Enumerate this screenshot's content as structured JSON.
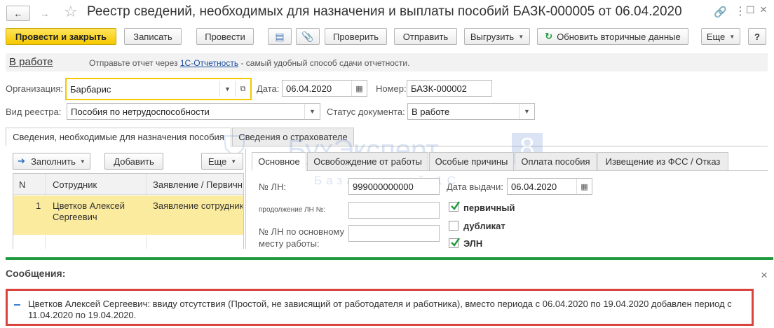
{
  "window": {
    "title": "Реестр сведений, необходимых для назначения и выплаты пособий БАЗК-000005 от 06.04.2020"
  },
  "toolbar": {
    "post_close": "Провести и закрыть",
    "save": "Записать",
    "post": "Провести",
    "check": "Проверить",
    "send": "Отправить",
    "upload": "Выгрузить",
    "refresh": "Обновить вторичные данные",
    "more": "Еще",
    "help": "?"
  },
  "status": {
    "state": "В работе",
    "hint_prefix": "Отправьте отчет через",
    "hint_link": "1С-Отчетность",
    "hint_suffix": "- самый удобный способ сдачи отчетности."
  },
  "form": {
    "org_label": "Организация:",
    "org_value": "Барбарис",
    "date_label": "Дата:",
    "date_value": "06.04.2020",
    "number_label": "Номер:",
    "number_value": "БАЗК-000002",
    "registry_type_label": "Вид реестра:",
    "registry_type_value": "Пособия по нетрудоспособности",
    "doc_status_label": "Статус документа:",
    "doc_status_value": "В работе"
  },
  "main_tabs": [
    "Сведения, необходимые для назначения пособия",
    "Сведения о страхователе"
  ],
  "left_panel": {
    "fill": "Заполнить",
    "add": "Добавить",
    "more": "Еще",
    "columns": [
      "N",
      "Сотрудник",
      "Заявление / Первичн"
    ],
    "rows": [
      {
        "n": "1",
        "employee": "Цветков Алексей Сергеевич",
        "application": "Заявление сотрудника"
      }
    ]
  },
  "sub_tabs": [
    "Основное",
    "Освобождение от работы",
    "Особые причины",
    "Оплата пособия",
    "Извещение из ФСС / Отказ"
  ],
  "detail": {
    "ln_label": "№ ЛН:",
    "ln_value": "999000000000",
    "issue_date_label": "Дата выдачи:",
    "issue_date_value": "06.04.2020",
    "continuation_label": "продолжение ЛН №:",
    "main_job_label": "№ ЛН по основному месту работы:",
    "primary": "первичный",
    "duplicate": "дубликат",
    "eln": "ЭЛН",
    "primary_checked": true,
    "duplicate_checked": false,
    "eln_checked": true
  },
  "watermark": {
    "title": "БухЭксперт",
    "number": "8",
    "subtitle": "База знаний 1С"
  },
  "messages": {
    "title": "Сообщения:",
    "close": "×",
    "text": "Цветков Алексей Сергеевич: ввиду отсутствия (Простой, не зависящий от работодателя и работника), вместо периода с 06.04.2020 по 19.04.2020 добавлен период с 11.04.2020 по 19.04.2020."
  },
  "colors": {
    "primary_button": "#f5c800",
    "selected_row": "#fbeb9e",
    "accent_green": "#1f9a3e",
    "message_border": "#d9443e",
    "link": "#1a4fa3"
  }
}
